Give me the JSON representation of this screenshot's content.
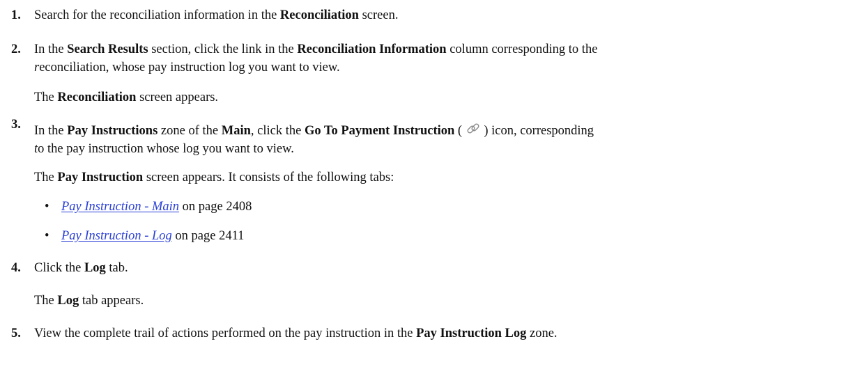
{
  "steps": [
    {
      "number": "1.",
      "t1": "Search for the reconciliation information in the ",
      "b1": "Reconciliation",
      "t2": " screen."
    },
    {
      "number": "2.",
      "t1": "In the ",
      "b1": "Search Results",
      "t2": " section, click the link in the ",
      "b2": "Reconciliation Information",
      "t3": " column corresponding to the",
      "i1": "r",
      "t4": "econciliation, whose pay instruction log you want to view.",
      "result_b1": "Reconciliation",
      "result_t1": " screen appears."
    },
    {
      "number": "3.",
      "t1": "In the ",
      "b1": "Pay Instructions",
      "t2": " zone of the ",
      "b2": "Main",
      "t3": ", click the ",
      "b3": "Go To Payment Instruction",
      "t4": " ( ",
      "icon": "link-icon",
      "t5": " ) icon, corresponding",
      "i1": "t",
      "t6": "o the pay instruction whose log you want to view.",
      "result_t0": "The ",
      "result_b1": "Pay Instruction",
      "result_t1": " screen appears. It consists of the following tabs:",
      "tabs": [
        {
          "bullet": "•",
          "link": "Pay Instruction - Main",
          "suffix": " on page 2408"
        },
        {
          "bullet": "•",
          "link": "Pay Instruction - Log",
          "suffix": " on page 2411"
        }
      ]
    },
    {
      "number": "4.",
      "t1": "Click the ",
      "b1": "Log",
      "t2": " tab.",
      "result_t0": "The ",
      "result_b1": "Log",
      "result_t1": " tab appears."
    },
    {
      "number": "5.",
      "t1": "View the complete trail of actions performed on the pay instruction in the ",
      "b1": "Pay Instruction Log",
      "t2": " zone."
    }
  ],
  "common": {
    "the": "The "
  },
  "colors": {
    "link": "#2a3fd6",
    "text": "#111111"
  }
}
